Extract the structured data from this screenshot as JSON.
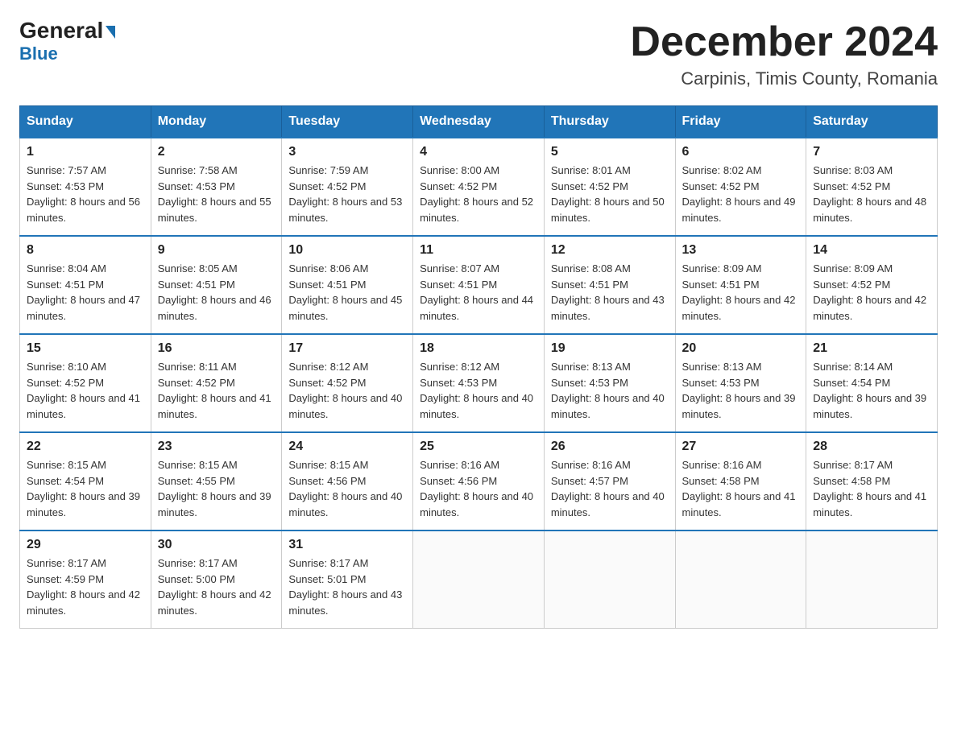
{
  "header": {
    "logo_line1": "General",
    "logo_line2": "Blue",
    "month_title": "December 2024",
    "location": "Carpinis, Timis County, Romania"
  },
  "days_of_week": [
    "Sunday",
    "Monday",
    "Tuesday",
    "Wednesday",
    "Thursday",
    "Friday",
    "Saturday"
  ],
  "weeks": [
    [
      {
        "day": "1",
        "sunrise": "7:57 AM",
        "sunset": "4:53 PM",
        "daylight": "8 hours and 56 minutes."
      },
      {
        "day": "2",
        "sunrise": "7:58 AM",
        "sunset": "4:53 PM",
        "daylight": "8 hours and 55 minutes."
      },
      {
        "day": "3",
        "sunrise": "7:59 AM",
        "sunset": "4:52 PM",
        "daylight": "8 hours and 53 minutes."
      },
      {
        "day": "4",
        "sunrise": "8:00 AM",
        "sunset": "4:52 PM",
        "daylight": "8 hours and 52 minutes."
      },
      {
        "day": "5",
        "sunrise": "8:01 AM",
        "sunset": "4:52 PM",
        "daylight": "8 hours and 50 minutes."
      },
      {
        "day": "6",
        "sunrise": "8:02 AM",
        "sunset": "4:52 PM",
        "daylight": "8 hours and 49 minutes."
      },
      {
        "day": "7",
        "sunrise": "8:03 AM",
        "sunset": "4:52 PM",
        "daylight": "8 hours and 48 minutes."
      }
    ],
    [
      {
        "day": "8",
        "sunrise": "8:04 AM",
        "sunset": "4:51 PM",
        "daylight": "8 hours and 47 minutes."
      },
      {
        "day": "9",
        "sunrise": "8:05 AM",
        "sunset": "4:51 PM",
        "daylight": "8 hours and 46 minutes."
      },
      {
        "day": "10",
        "sunrise": "8:06 AM",
        "sunset": "4:51 PM",
        "daylight": "8 hours and 45 minutes."
      },
      {
        "day": "11",
        "sunrise": "8:07 AM",
        "sunset": "4:51 PM",
        "daylight": "8 hours and 44 minutes."
      },
      {
        "day": "12",
        "sunrise": "8:08 AM",
        "sunset": "4:51 PM",
        "daylight": "8 hours and 43 minutes."
      },
      {
        "day": "13",
        "sunrise": "8:09 AM",
        "sunset": "4:51 PM",
        "daylight": "8 hours and 42 minutes."
      },
      {
        "day": "14",
        "sunrise": "8:09 AM",
        "sunset": "4:52 PM",
        "daylight": "8 hours and 42 minutes."
      }
    ],
    [
      {
        "day": "15",
        "sunrise": "8:10 AM",
        "sunset": "4:52 PM",
        "daylight": "8 hours and 41 minutes."
      },
      {
        "day": "16",
        "sunrise": "8:11 AM",
        "sunset": "4:52 PM",
        "daylight": "8 hours and 41 minutes."
      },
      {
        "day": "17",
        "sunrise": "8:12 AM",
        "sunset": "4:52 PM",
        "daylight": "8 hours and 40 minutes."
      },
      {
        "day": "18",
        "sunrise": "8:12 AM",
        "sunset": "4:53 PM",
        "daylight": "8 hours and 40 minutes."
      },
      {
        "day": "19",
        "sunrise": "8:13 AM",
        "sunset": "4:53 PM",
        "daylight": "8 hours and 40 minutes."
      },
      {
        "day": "20",
        "sunrise": "8:13 AM",
        "sunset": "4:53 PM",
        "daylight": "8 hours and 39 minutes."
      },
      {
        "day": "21",
        "sunrise": "8:14 AM",
        "sunset": "4:54 PM",
        "daylight": "8 hours and 39 minutes."
      }
    ],
    [
      {
        "day": "22",
        "sunrise": "8:15 AM",
        "sunset": "4:54 PM",
        "daylight": "8 hours and 39 minutes."
      },
      {
        "day": "23",
        "sunrise": "8:15 AM",
        "sunset": "4:55 PM",
        "daylight": "8 hours and 39 minutes."
      },
      {
        "day": "24",
        "sunrise": "8:15 AM",
        "sunset": "4:56 PM",
        "daylight": "8 hours and 40 minutes."
      },
      {
        "day": "25",
        "sunrise": "8:16 AM",
        "sunset": "4:56 PM",
        "daylight": "8 hours and 40 minutes."
      },
      {
        "day": "26",
        "sunrise": "8:16 AM",
        "sunset": "4:57 PM",
        "daylight": "8 hours and 40 minutes."
      },
      {
        "day": "27",
        "sunrise": "8:16 AM",
        "sunset": "4:58 PM",
        "daylight": "8 hours and 41 minutes."
      },
      {
        "day": "28",
        "sunrise": "8:17 AM",
        "sunset": "4:58 PM",
        "daylight": "8 hours and 41 minutes."
      }
    ],
    [
      {
        "day": "29",
        "sunrise": "8:17 AM",
        "sunset": "4:59 PM",
        "daylight": "8 hours and 42 minutes."
      },
      {
        "day": "30",
        "sunrise": "8:17 AM",
        "sunset": "5:00 PM",
        "daylight": "8 hours and 42 minutes."
      },
      {
        "day": "31",
        "sunrise": "8:17 AM",
        "sunset": "5:01 PM",
        "daylight": "8 hours and 43 minutes."
      },
      null,
      null,
      null,
      null
    ]
  ]
}
